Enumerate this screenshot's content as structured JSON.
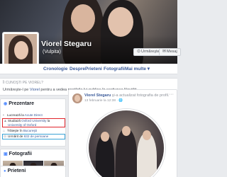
{
  "profile": {
    "name": "Viorel Stegaru",
    "alternate_name": "(Vulpita)"
  },
  "cover_actions": {
    "follow_label": "Urmăreşte",
    "follow_icon": "rss-icon",
    "message_label": "Mesaj",
    "message_icon": "messenger-icon"
  },
  "nav": {
    "items": [
      "Cronologie",
      "Despre",
      "Prieteni",
      "Fotografii",
      "Mai multe ▾"
    ]
  },
  "know_box": {
    "header": "Îl CUNOŞTI PE VIOREL?",
    "text_prefix": "Urmăreşte-l pe ",
    "text_link": "Viorel",
    "text_suffix": " pentru a vedea postările lui publice în secțiunea Noutăți."
  },
  "intro": {
    "title": "Prezentare",
    "rows": [
      {
        "prefix": "Lucrează la ",
        "link": "Acute Direct"
      },
      {
        "prefix": "Studiază ",
        "link": "Oxford University",
        "suffix": " la ",
        "link2": "University of Oxford"
      },
      {
        "prefix": "Trăieşte în ",
        "link": "Bucureşti"
      },
      {
        "prefix": "Urmărit de ",
        "link": "632 de persoane"
      }
    ]
  },
  "photos": {
    "title": "Fotografii"
  },
  "friends": {
    "title": "Prieteni"
  },
  "post": {
    "author": "Viorel Stegaru",
    "action": " şi-a actualizat fotografia de profil.",
    "date": "13 februarie la 12:38 · 🌐",
    "menu_label": "···"
  },
  "colors": {
    "link": "#385898",
    "highlight_red": "#e0242b",
    "highlight_blue": "#3ba3d6"
  }
}
